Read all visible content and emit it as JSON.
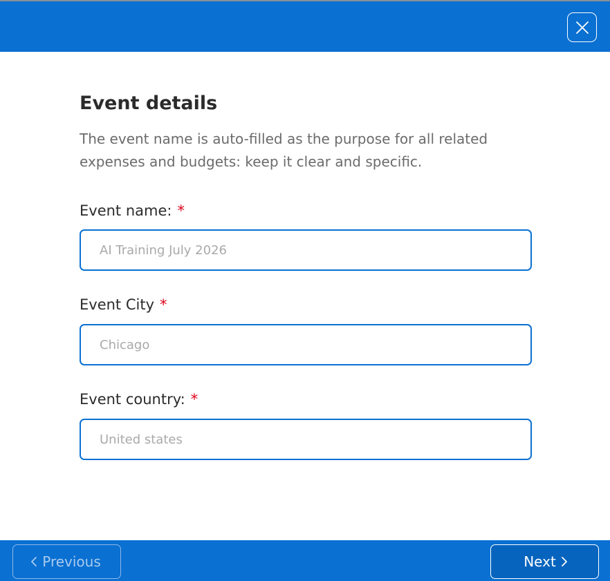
{
  "header": {
    "close_icon": "close-icon"
  },
  "main": {
    "title": "Event details",
    "description": "The event name is auto-filled as the purpose for all related expenses and budgets: keep it clear and specific.",
    "required_marker": "*",
    "fields": [
      {
        "label": "Event name:",
        "placeholder": "AI Training July 2026",
        "value": ""
      },
      {
        "label": "Event City",
        "placeholder": "Chicago",
        "value": ""
      },
      {
        "label": "Event country:",
        "placeholder": "United states",
        "value": ""
      }
    ]
  },
  "footer": {
    "previous_label": "Previous",
    "next_label": "Next",
    "previous_icon": "chevron-left-icon",
    "next_icon": "chevron-right-icon"
  },
  "colors": {
    "brand_blue": "#0a70d2",
    "required_red": "#e0001b",
    "text_dark": "#2b2b2b",
    "text_muted": "#6b6b6b",
    "placeholder": "#a9a9a9"
  }
}
